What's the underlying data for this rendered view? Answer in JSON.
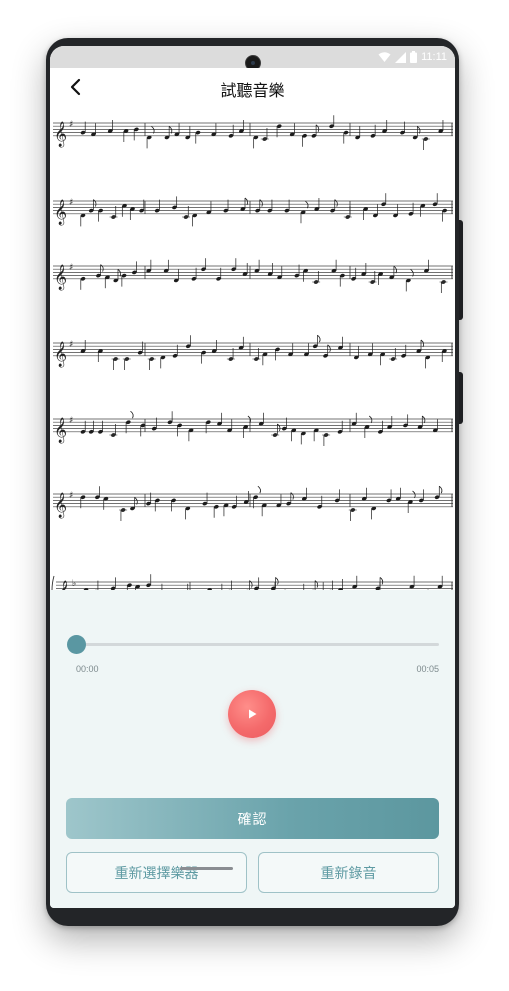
{
  "status_bar": {
    "time": "11:11",
    "icons": [
      "wifi-icon",
      "signal-icon",
      "battery-icon"
    ]
  },
  "header": {
    "title": "試聽音樂",
    "back_icon": "chevron-left-icon"
  },
  "player": {
    "progress": 0.0,
    "current_time": "00:00",
    "total_time": "00:05",
    "play_icon": "play-icon"
  },
  "actions": {
    "confirm_label": "確認",
    "reselect_instrument_label": "重新選擇樂器",
    "rerecord_label": "重新錄音"
  },
  "colors": {
    "accent": "#5a97a2",
    "play": "#f46a6b",
    "panel_bg": "#eff6f6"
  }
}
